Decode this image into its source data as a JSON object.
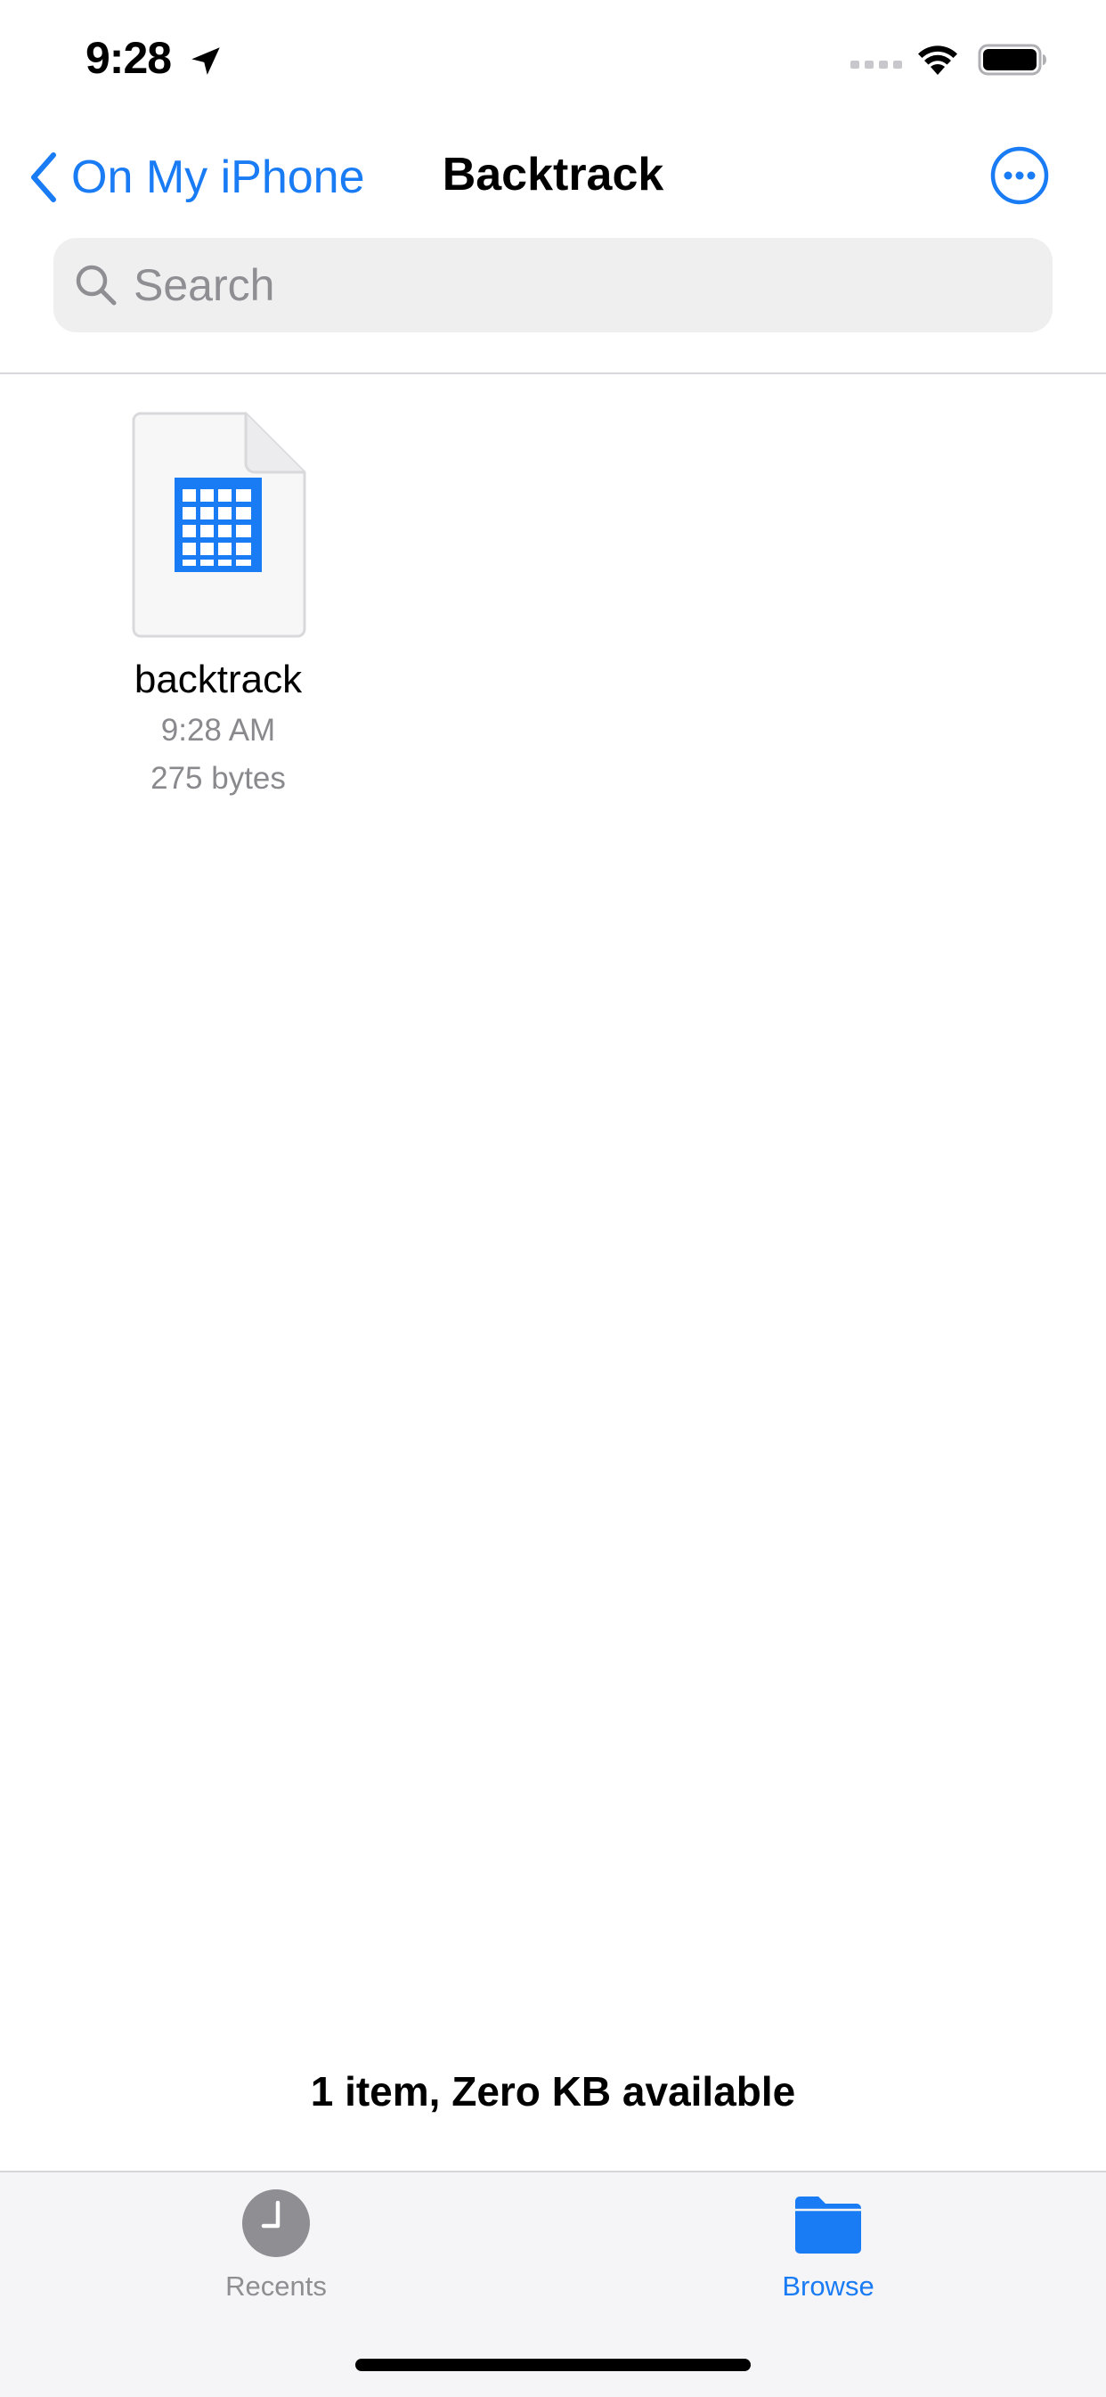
{
  "status_bar": {
    "time": "9:28",
    "location_icon": "location-arrow-icon",
    "wifi_icon": "wifi-icon",
    "battery_icon": "battery-icon"
  },
  "nav": {
    "back_label": "On My iPhone",
    "title": "Backtrack",
    "more_icon": "ellipsis-circle-icon"
  },
  "search": {
    "placeholder": "Search",
    "value": ""
  },
  "files": [
    {
      "name": "backtrack",
      "modified": "9:28 AM",
      "size": "275 bytes",
      "icon": "spreadsheet-icon"
    }
  ],
  "footer": {
    "storage_text": "1 item, Zero KB available"
  },
  "tabs": [
    {
      "label": "Recents",
      "icon": "clock-icon",
      "active": false
    },
    {
      "label": "Browse",
      "icon": "folder-icon",
      "active": true
    }
  ],
  "colors": {
    "accent": "#1a7cf5",
    "secondary_text": "#8a8a8e",
    "search_bg": "#efeff0",
    "tabbar_bg": "#f5f5f7"
  }
}
